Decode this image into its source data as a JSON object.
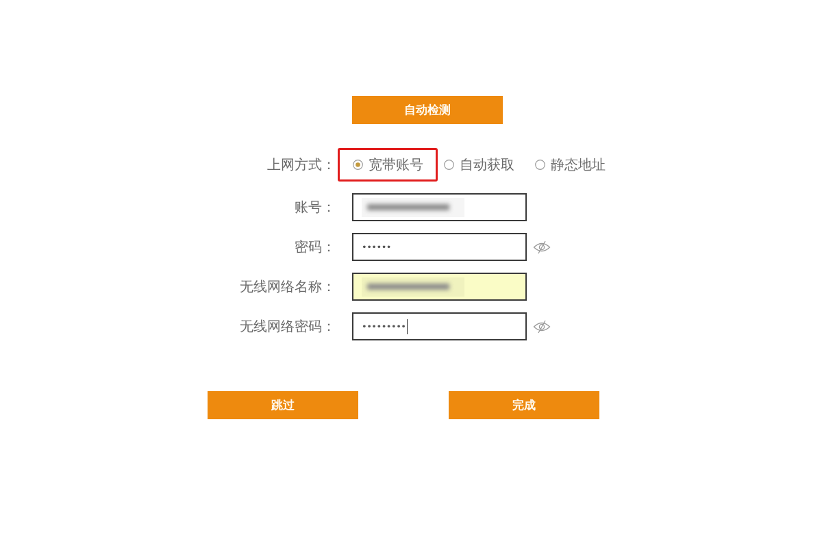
{
  "detect_button": {
    "label": "自动检测"
  },
  "connection": {
    "label": "上网方式：",
    "options": [
      {
        "label": "宽带账号",
        "selected": true,
        "highlighted": true
      },
      {
        "label": "自动获取",
        "selected": false,
        "highlighted": false
      },
      {
        "label": "静态地址",
        "selected": false,
        "highlighted": false
      }
    ]
  },
  "fields": [
    {
      "label": "账号：",
      "kind": "text",
      "blurred": true,
      "autofilled": false,
      "focused": false
    },
    {
      "label": "密码：",
      "kind": "password",
      "value": "••••••",
      "blurred": false,
      "autofilled": false,
      "focused": false
    },
    {
      "label": "无线网络名称：",
      "kind": "text",
      "blurred": true,
      "autofilled": true,
      "focused": false
    },
    {
      "label": "无线网络密码：",
      "kind": "password",
      "value": "•••••••••",
      "blurred": false,
      "autofilled": false,
      "focused": true
    }
  ],
  "buttons": [
    {
      "label": "跳过"
    },
    {
      "label": "完成"
    }
  ]
}
